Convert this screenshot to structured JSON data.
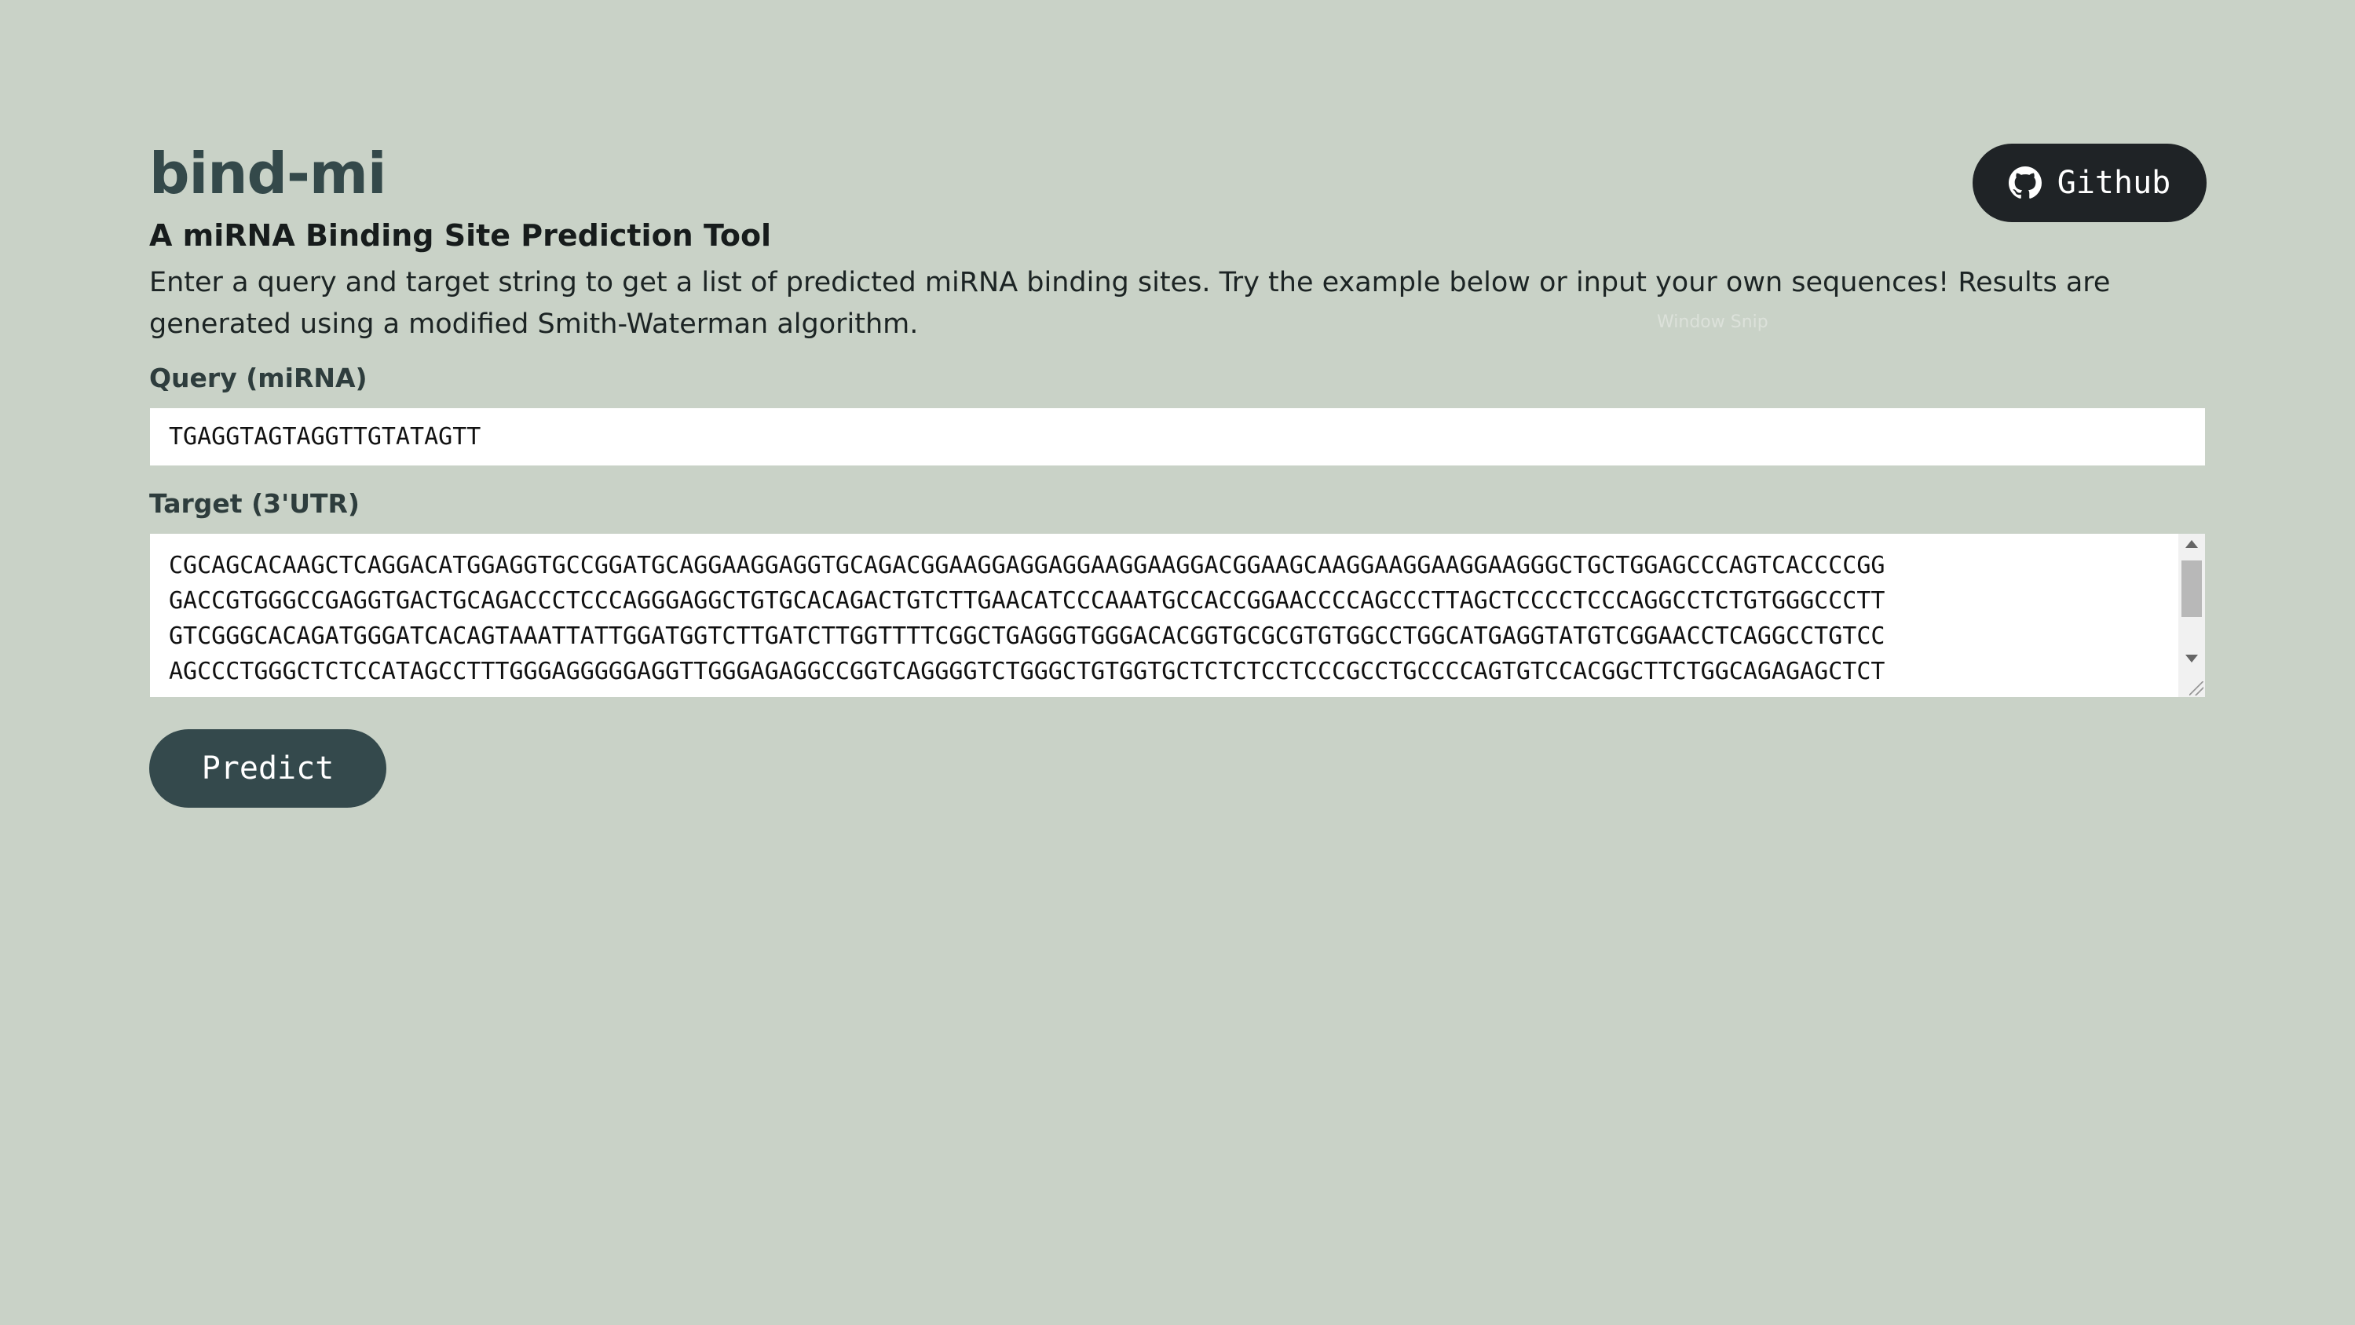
{
  "header": {
    "title": "bind-mi",
    "github_label": "Github"
  },
  "intro": {
    "subtitle": "A miRNA Binding Site Prediction Tool",
    "description": "Enter a query and target string to get a list of predicted miRNA binding sites. Try the example below or input your own sequences! Results are generated using a modified Smith-Waterman algorithm."
  },
  "query": {
    "label": "Query (miRNA)",
    "value": "TGAGGTAGTAGGTTGTATAGTT"
  },
  "target": {
    "label": "Target (3'UTR)",
    "lines": [
      "CGCAGCACAAGCTCAGGACATGGAGGTGCCGGATGCAGGAAGGAGGTGCAGACGGAAGGAGGAGGAAGGAAGGACGGAAGCAAGGAAGGAAGGAAGGGCTGCTGGAGCCCAGTCACCCCGG",
      "GACCGTGGGCCGAGGTGACTGCAGACCCTCCCAGGGAGGCTGTGCACAGACTGTCTTGAACATCCCAAATGCCACCGGAACCCCAGCCCTTAGCTCCCCTCCCAGGCCTCTGTGGGCCCTT",
      "GTCGGGCACAGATGGGATCACAGTAAATTATTGGATGGTCTTGATCTTGGTTTTCGGCTGAGGGTGGGACACGGTGCGCGTGTGGCCTGGCATGAGGTATGTCGGAACCTCAGGCCTGTCC",
      "AGCCCTGGGCTCTCCATAGCCTTTGGGAGGGGGAGGTTGGGAGAGGCCGGTCAGGGGTCTGGGCTGTGGTGCTCTCTCCTCCCGCCTGCCCCAGTGTCCACGGCTTCTGGCAGAGAGCTCT"
    ]
  },
  "actions": {
    "predict_label": "Predict"
  },
  "overlay": {
    "watermark": "Window Snip"
  },
  "colors": {
    "background": "#c9d2c7",
    "title": "#34494a",
    "github_button": "#1f2326",
    "predict_button": "#34494c"
  },
  "icons": {
    "github": "github-icon"
  }
}
